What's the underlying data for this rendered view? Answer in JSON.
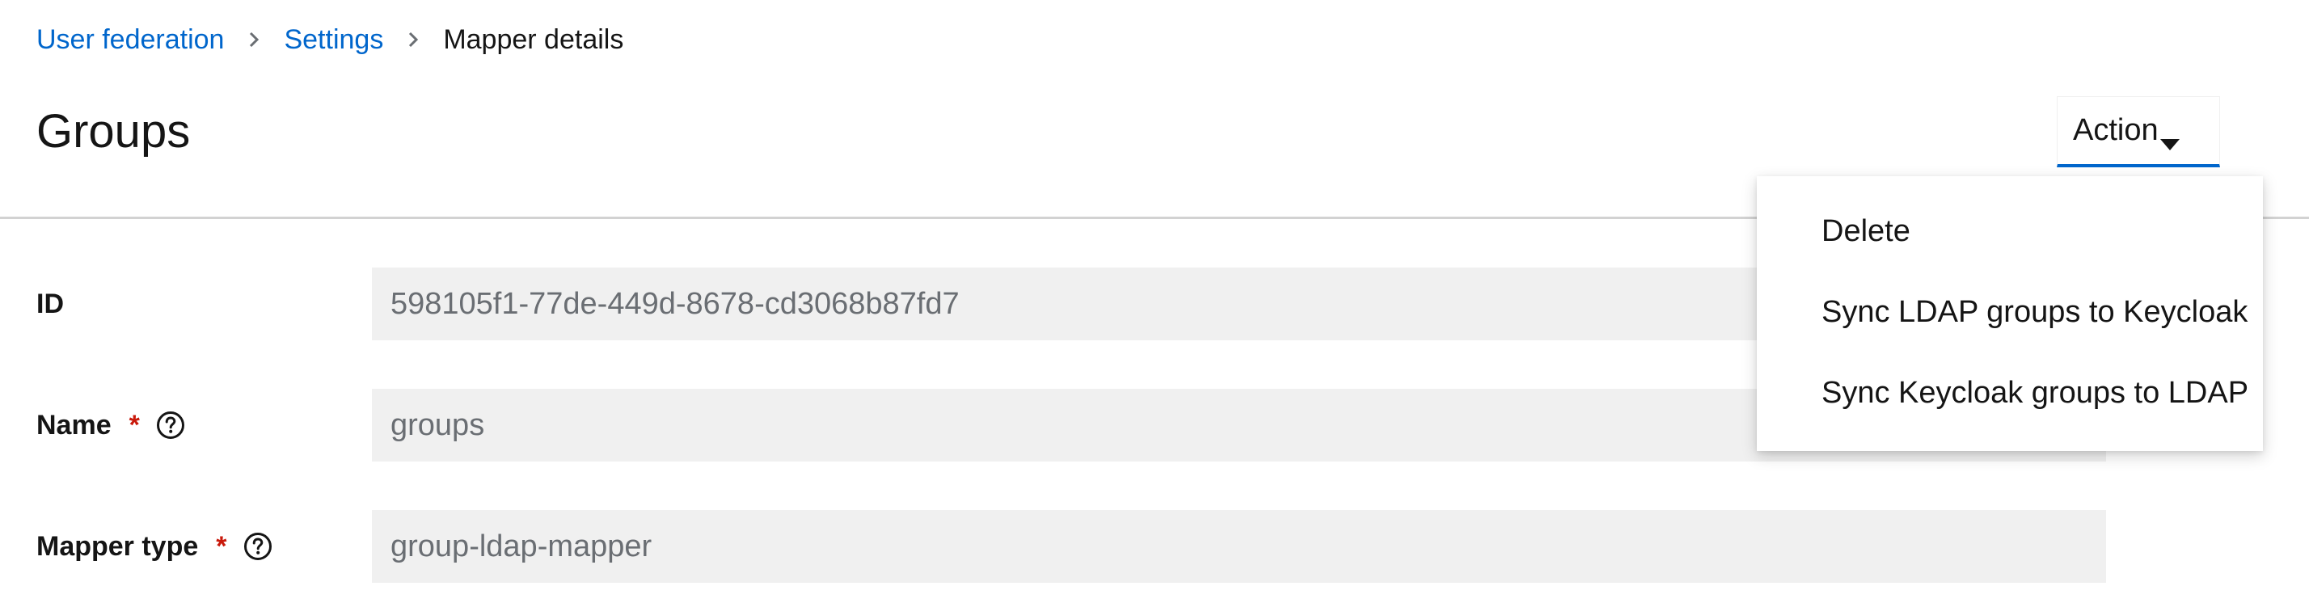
{
  "breadcrumb": {
    "items": [
      {
        "label": "User federation"
      },
      {
        "label": "Settings"
      }
    ],
    "current": "Mapper details"
  },
  "header": {
    "title": "Groups",
    "action_label": "Action"
  },
  "form": {
    "id": {
      "label": "ID",
      "value": "598105f1-77de-449d-8678-cd3068b87fd7"
    },
    "name": {
      "label": "Name",
      "required_marker": "*",
      "value": "groups"
    },
    "mapper_type": {
      "label": "Mapper type",
      "required_marker": "*",
      "value": "group-ldap-mapper"
    }
  },
  "action_menu": {
    "items": [
      {
        "label": "Delete"
      },
      {
        "label": "Sync LDAP groups to Keycloak"
      },
      {
        "label": "Sync Keycloak groups to LDAP"
      }
    ]
  },
  "colors": {
    "link": "#0066cc",
    "required": "#c9190b",
    "input_bg": "#f0f0f0",
    "divider": "#d2d2d2"
  },
  "icons": {
    "breadcrumb_separator": "chevron-right-icon",
    "action_caret": "caret-down-icon",
    "help": "help-circle-icon"
  }
}
